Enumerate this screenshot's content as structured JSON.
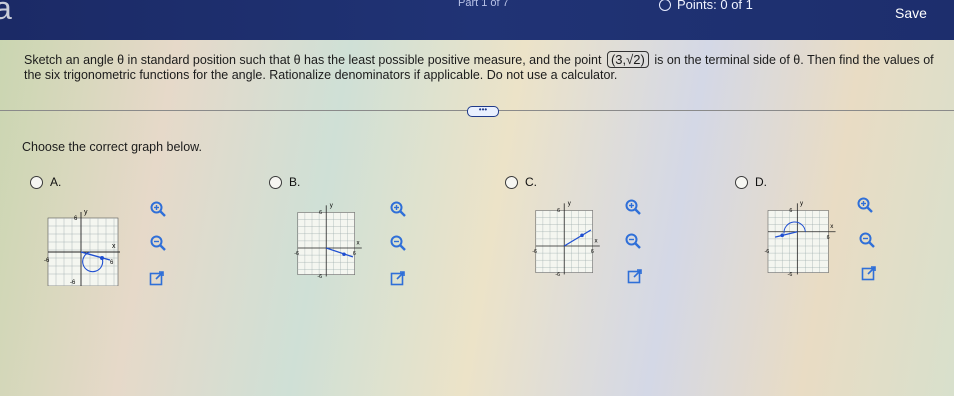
{
  "header": {
    "logo_char": "a",
    "part_text": "Part 1 of 7",
    "points_text": "Points: 0 of 1",
    "save_label": "Save"
  },
  "question": {
    "text_before": "Sketch an angle θ in standard position such that θ has the least possible positive measure, and the point",
    "point": "(3,√2)",
    "text_after": "is on the terminal side of θ. Then find the values of the six trigonometric functions for the angle. Rationalize denominators if applicable. Do not use a calculator."
  },
  "more_dots": "•••",
  "prompt": "Choose the correct graph below.",
  "options": [
    {
      "label": "A.",
      "graph": {
        "ytop": "6",
        "yneg": "-6",
        "xneg": "-6",
        "xpos": "6",
        "xlab": "x",
        "ylab": "y"
      }
    },
    {
      "label": "B.",
      "graph": {
        "ytop": "6",
        "yneg": "-6",
        "xneg": "-6",
        "xpos": "6",
        "xlab": "x",
        "ylab": "y"
      }
    },
    {
      "label": "C.",
      "graph": {
        "ytop": "6",
        "yneg": "-6",
        "xneg": "-6",
        "xpos": "6",
        "xlab": "x",
        "ylab": "y"
      }
    },
    {
      "label": "D.",
      "graph": {
        "ytop": "6",
        "yneg": "-6",
        "xneg": "-6",
        "xpos": "6",
        "xlab": "x",
        "ylab": "y"
      }
    }
  ],
  "colors": {
    "header_bg": "#1d2e6d",
    "accent_blue": "#1f4fd1",
    "icon_blue": "#2f6fd8"
  }
}
